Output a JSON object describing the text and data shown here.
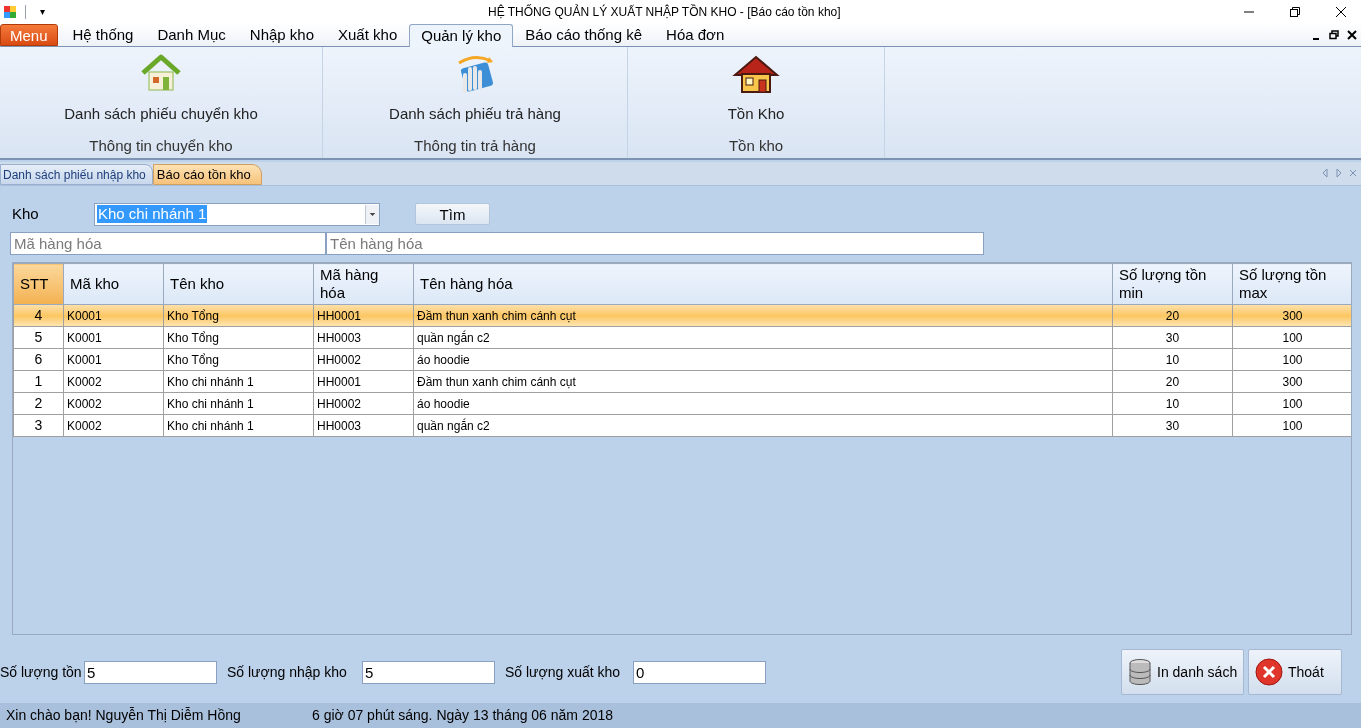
{
  "window": {
    "title": "HỆ THỐNG QUẢN LÝ XUẤT NHẬP TỒN KHO - [Báo cáo tồn kho]",
    "quick_access": "▾"
  },
  "ribbon_tabs": [
    {
      "label": "Menu",
      "kind": "app",
      "selected": false
    },
    {
      "label": "Hệ thống",
      "kind": "tab",
      "selected": false
    },
    {
      "label": "Danh Mục",
      "kind": "tab",
      "selected": false
    },
    {
      "label": "Nhập kho",
      "kind": "tab",
      "selected": false
    },
    {
      "label": "Xuất kho",
      "kind": "tab",
      "selected": false
    },
    {
      "label": "Quản lý kho",
      "kind": "tab",
      "selected": true
    },
    {
      "label": "Báo cáo thống kê",
      "kind": "tab",
      "selected": false
    },
    {
      "label": "Hóa đơn",
      "kind": "tab",
      "selected": false
    }
  ],
  "ribbon_groups": [
    {
      "button": "Danh sách phiếu chuyển kho",
      "label": "Thông tin chuyển kho",
      "kind": "green-house"
    },
    {
      "button": "Danh sách phiếu trả hàng",
      "label": "Thông tin trả hàng",
      "kind": "hand"
    },
    {
      "button": "Tồn Kho",
      "label": "Tồn kho",
      "kind": "red-house"
    }
  ],
  "document_tabs": [
    {
      "label": "Danh sách phiếu nhập kho",
      "selected": false
    },
    {
      "label": "Báo cáo tồn kho",
      "selected": true
    }
  ],
  "filter": {
    "kho_label": "Kho",
    "kho_value": "Kho chi nhánh 1",
    "find_button": "Tìm",
    "code_placeholder": "Mã hàng hóa",
    "name_placeholder": "Tên hàng hóa"
  },
  "table": {
    "columns": [
      "STT",
      "Mã kho",
      "Tên kho",
      "Mã hàng hóa",
      "Tên hàng hóa",
      "Số lượng tồn min",
      "Số lượng tồn max"
    ],
    "rows": [
      {
        "cells": [
          "4",
          "K0001",
          "Kho Tổng",
          "HH0001",
          "Đầm thun xanh chim cánh cụt",
          "20",
          "300"
        ],
        "selected": true
      },
      {
        "cells": [
          "5",
          "K0001",
          "Kho Tổng",
          "HH0003",
          "quần ngắn c2",
          "30",
          "100"
        ],
        "selected": false
      },
      {
        "cells": [
          "6",
          "K0001",
          "Kho Tổng",
          "HH0002",
          "áo hoodie",
          "10",
          "100"
        ],
        "selected": false
      },
      {
        "cells": [
          "1",
          "K0002",
          "Kho chi nhánh 1",
          "HH0001",
          "Đầm thun xanh chim cánh cụt",
          "20",
          "300"
        ],
        "selected": false
      },
      {
        "cells": [
          "2",
          "K0002",
          "Kho chi nhánh 1",
          "HH0002",
          "áo hoodie",
          "10",
          "100"
        ],
        "selected": false
      },
      {
        "cells": [
          "3",
          "K0002",
          "Kho chi nhánh 1",
          "HH0003",
          "quần ngắn c2",
          "30",
          "100"
        ],
        "selected": false
      }
    ]
  },
  "totals": [
    {
      "label": "Số lượng tồn",
      "value": "5"
    },
    {
      "label": "Số lượng nhập kho",
      "value": "5"
    },
    {
      "label": "Số lượng xuất kho",
      "value": "0"
    }
  ],
  "buttons": [
    {
      "label": "In danh sách",
      "kind": "print"
    },
    {
      "label": "Thoát",
      "kind": "exit"
    }
  ],
  "status_bar": {
    "greeting": "Xin chào bạn! Nguyễn Thị Diễm Hồng",
    "datetime": "6 giờ 07 phút sáng. Ngày 13 tháng 06 năm 2018"
  }
}
